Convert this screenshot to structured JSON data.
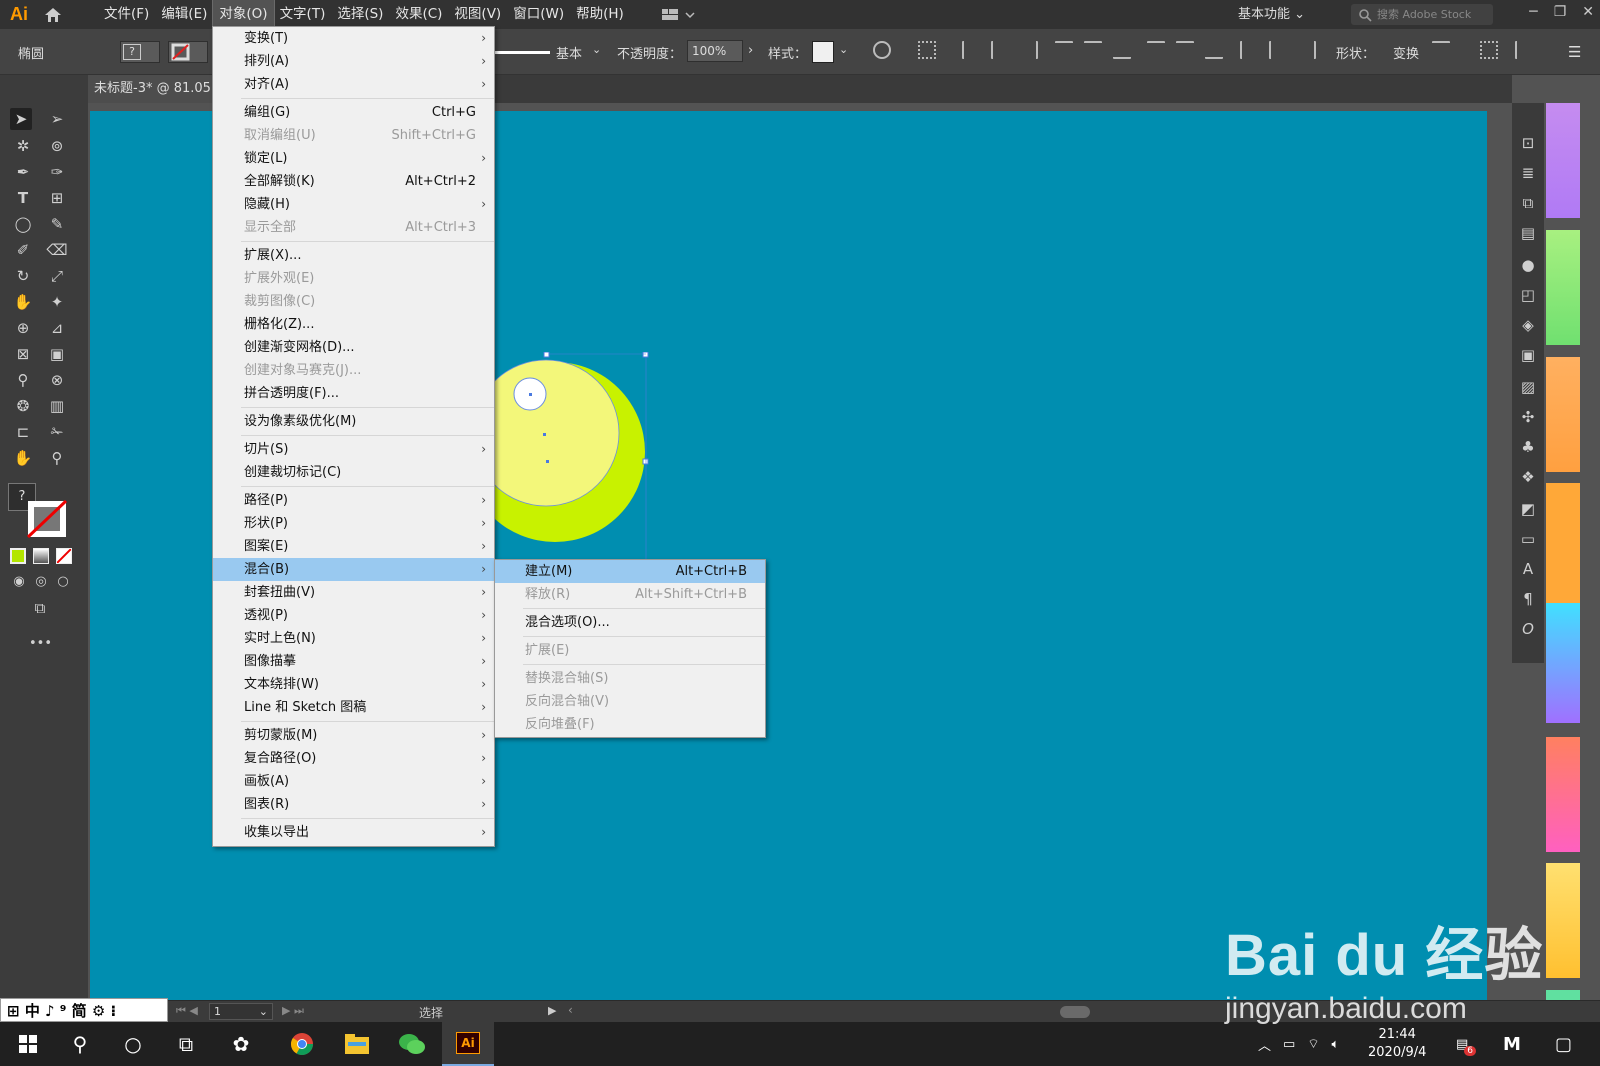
{
  "app": {
    "logo": "Ai"
  },
  "menubar": {
    "items": [
      "文件(F)",
      "编辑(E)",
      "对象(O)",
      "文字(T)",
      "选择(S)",
      "效果(C)",
      "视图(V)",
      "窗口(W)",
      "帮助(H)"
    ],
    "workspace": "基本功能",
    "stock_search_placeholder": "搜索 Adobe Stock"
  },
  "control": {
    "shape_label": "椭圆",
    "stroke_style": "基本",
    "opacity_label": "不透明度：",
    "opacity_value": "100%",
    "style_label": "样式：",
    "shape_right_label": "形状：",
    "transform_label": "变换"
  },
  "tab": {
    "title": "未标题-3* @ 81.05"
  },
  "object_menu": {
    "items": [
      {
        "label": "变换(T)",
        "shortcut": "",
        "submenu": true,
        "disabled": false
      },
      {
        "label": "排列(A)",
        "shortcut": "",
        "submenu": true,
        "disabled": false
      },
      {
        "label": "对齐(A)",
        "shortcut": "",
        "submenu": true,
        "disabled": false,
        "sep": true
      },
      {
        "label": "编组(G)",
        "shortcut": "Ctrl+G",
        "submenu": false,
        "disabled": false
      },
      {
        "label": "取消编组(U)",
        "shortcut": "Shift+Ctrl+G",
        "submenu": false,
        "disabled": true
      },
      {
        "label": "锁定(L)",
        "shortcut": "",
        "submenu": true,
        "disabled": false
      },
      {
        "label": "全部解锁(K)",
        "shortcut": "Alt+Ctrl+2",
        "submenu": false,
        "disabled": false
      },
      {
        "label": "隐藏(H)",
        "shortcut": "",
        "submenu": true,
        "disabled": false
      },
      {
        "label": "显示全部",
        "shortcut": "Alt+Ctrl+3",
        "submenu": false,
        "disabled": true,
        "sep": true
      },
      {
        "label": "扩展(X)...",
        "shortcut": "",
        "submenu": false,
        "disabled": false
      },
      {
        "label": "扩展外观(E)",
        "shortcut": "",
        "submenu": false,
        "disabled": true
      },
      {
        "label": "裁剪图像(C)",
        "shortcut": "",
        "submenu": false,
        "disabled": true
      },
      {
        "label": "栅格化(Z)...",
        "shortcut": "",
        "submenu": false,
        "disabled": false
      },
      {
        "label": "创建渐变网格(D)...",
        "shortcut": "",
        "submenu": false,
        "disabled": false
      },
      {
        "label": "创建对象马赛克(J)...",
        "shortcut": "",
        "submenu": false,
        "disabled": true
      },
      {
        "label": "拼合透明度(F)...",
        "shortcut": "",
        "submenu": false,
        "disabled": false,
        "sep": true
      },
      {
        "label": "设为像素级优化(M)",
        "shortcut": "",
        "submenu": false,
        "disabled": false,
        "sep": true
      },
      {
        "label": "切片(S)",
        "shortcut": "",
        "submenu": true,
        "disabled": false
      },
      {
        "label": "创建裁切标记(C)",
        "shortcut": "",
        "submenu": false,
        "disabled": false,
        "sep": true
      },
      {
        "label": "路径(P)",
        "shortcut": "",
        "submenu": true,
        "disabled": false
      },
      {
        "label": "形状(P)",
        "shortcut": "",
        "submenu": true,
        "disabled": false
      },
      {
        "label": "图案(E)",
        "shortcut": "",
        "submenu": true,
        "disabled": false
      },
      {
        "label": "混合(B)",
        "shortcut": "",
        "submenu": true,
        "disabled": false,
        "highlight": true
      },
      {
        "label": "封套扭曲(V)",
        "shortcut": "",
        "submenu": true,
        "disabled": false
      },
      {
        "label": "透视(P)",
        "shortcut": "",
        "submenu": true,
        "disabled": false
      },
      {
        "label": "实时上色(N)",
        "shortcut": "",
        "submenu": true,
        "disabled": false
      },
      {
        "label": "图像描摹",
        "shortcut": "",
        "submenu": true,
        "disabled": false
      },
      {
        "label": "文本绕排(W)",
        "shortcut": "",
        "submenu": true,
        "disabled": false
      },
      {
        "label": "Line 和 Sketch 图稿",
        "shortcut": "",
        "submenu": true,
        "disabled": false,
        "sep": true
      },
      {
        "label": "剪切蒙版(M)",
        "shortcut": "",
        "submenu": true,
        "disabled": false
      },
      {
        "label": "复合路径(O)",
        "shortcut": "",
        "submenu": true,
        "disabled": false
      },
      {
        "label": "画板(A)",
        "shortcut": "",
        "submenu": true,
        "disabled": false
      },
      {
        "label": "图表(R)",
        "shortcut": "",
        "submenu": true,
        "disabled": false,
        "sep": true
      },
      {
        "label": "收集以导出",
        "shortcut": "",
        "submenu": true,
        "disabled": false
      }
    ]
  },
  "blend_submenu": {
    "items": [
      {
        "label": "建立(M)",
        "shortcut": "Alt+Ctrl+B",
        "disabled": false,
        "highlight": true
      },
      {
        "label": "释放(R)",
        "shortcut": "Alt+Shift+Ctrl+B",
        "disabled": true,
        "sep": true
      },
      {
        "label": "混合选项(O)...",
        "shortcut": "",
        "disabled": false,
        "sep": true
      },
      {
        "label": "扩展(E)",
        "shortcut": "",
        "disabled": true,
        "sep": true
      },
      {
        "label": "替换混合轴(S)",
        "shortcut": "",
        "disabled": true
      },
      {
        "label": "反向混合轴(V)",
        "shortcut": "",
        "disabled": true
      },
      {
        "label": "反向堆叠(F)",
        "shortcut": "",
        "disabled": true
      }
    ]
  },
  "status": {
    "zoom_page": "1",
    "tool": "选择"
  },
  "ime": {
    "text": "中 ♪ ⁹ 简 ⚙ ⁝"
  },
  "taskbar": {
    "time": "21:44",
    "date": "2020/9/4",
    "notif_count": "6"
  },
  "watermark": {
    "brand": "Bai du 经验",
    "url": "jingyan.baidu.com"
  },
  "colors": {
    "artboard": "#008eb0",
    "circle_outer": "#c8f200",
    "circle_inner": "#f3f77a",
    "menu_highlight": "#99c9f0"
  }
}
